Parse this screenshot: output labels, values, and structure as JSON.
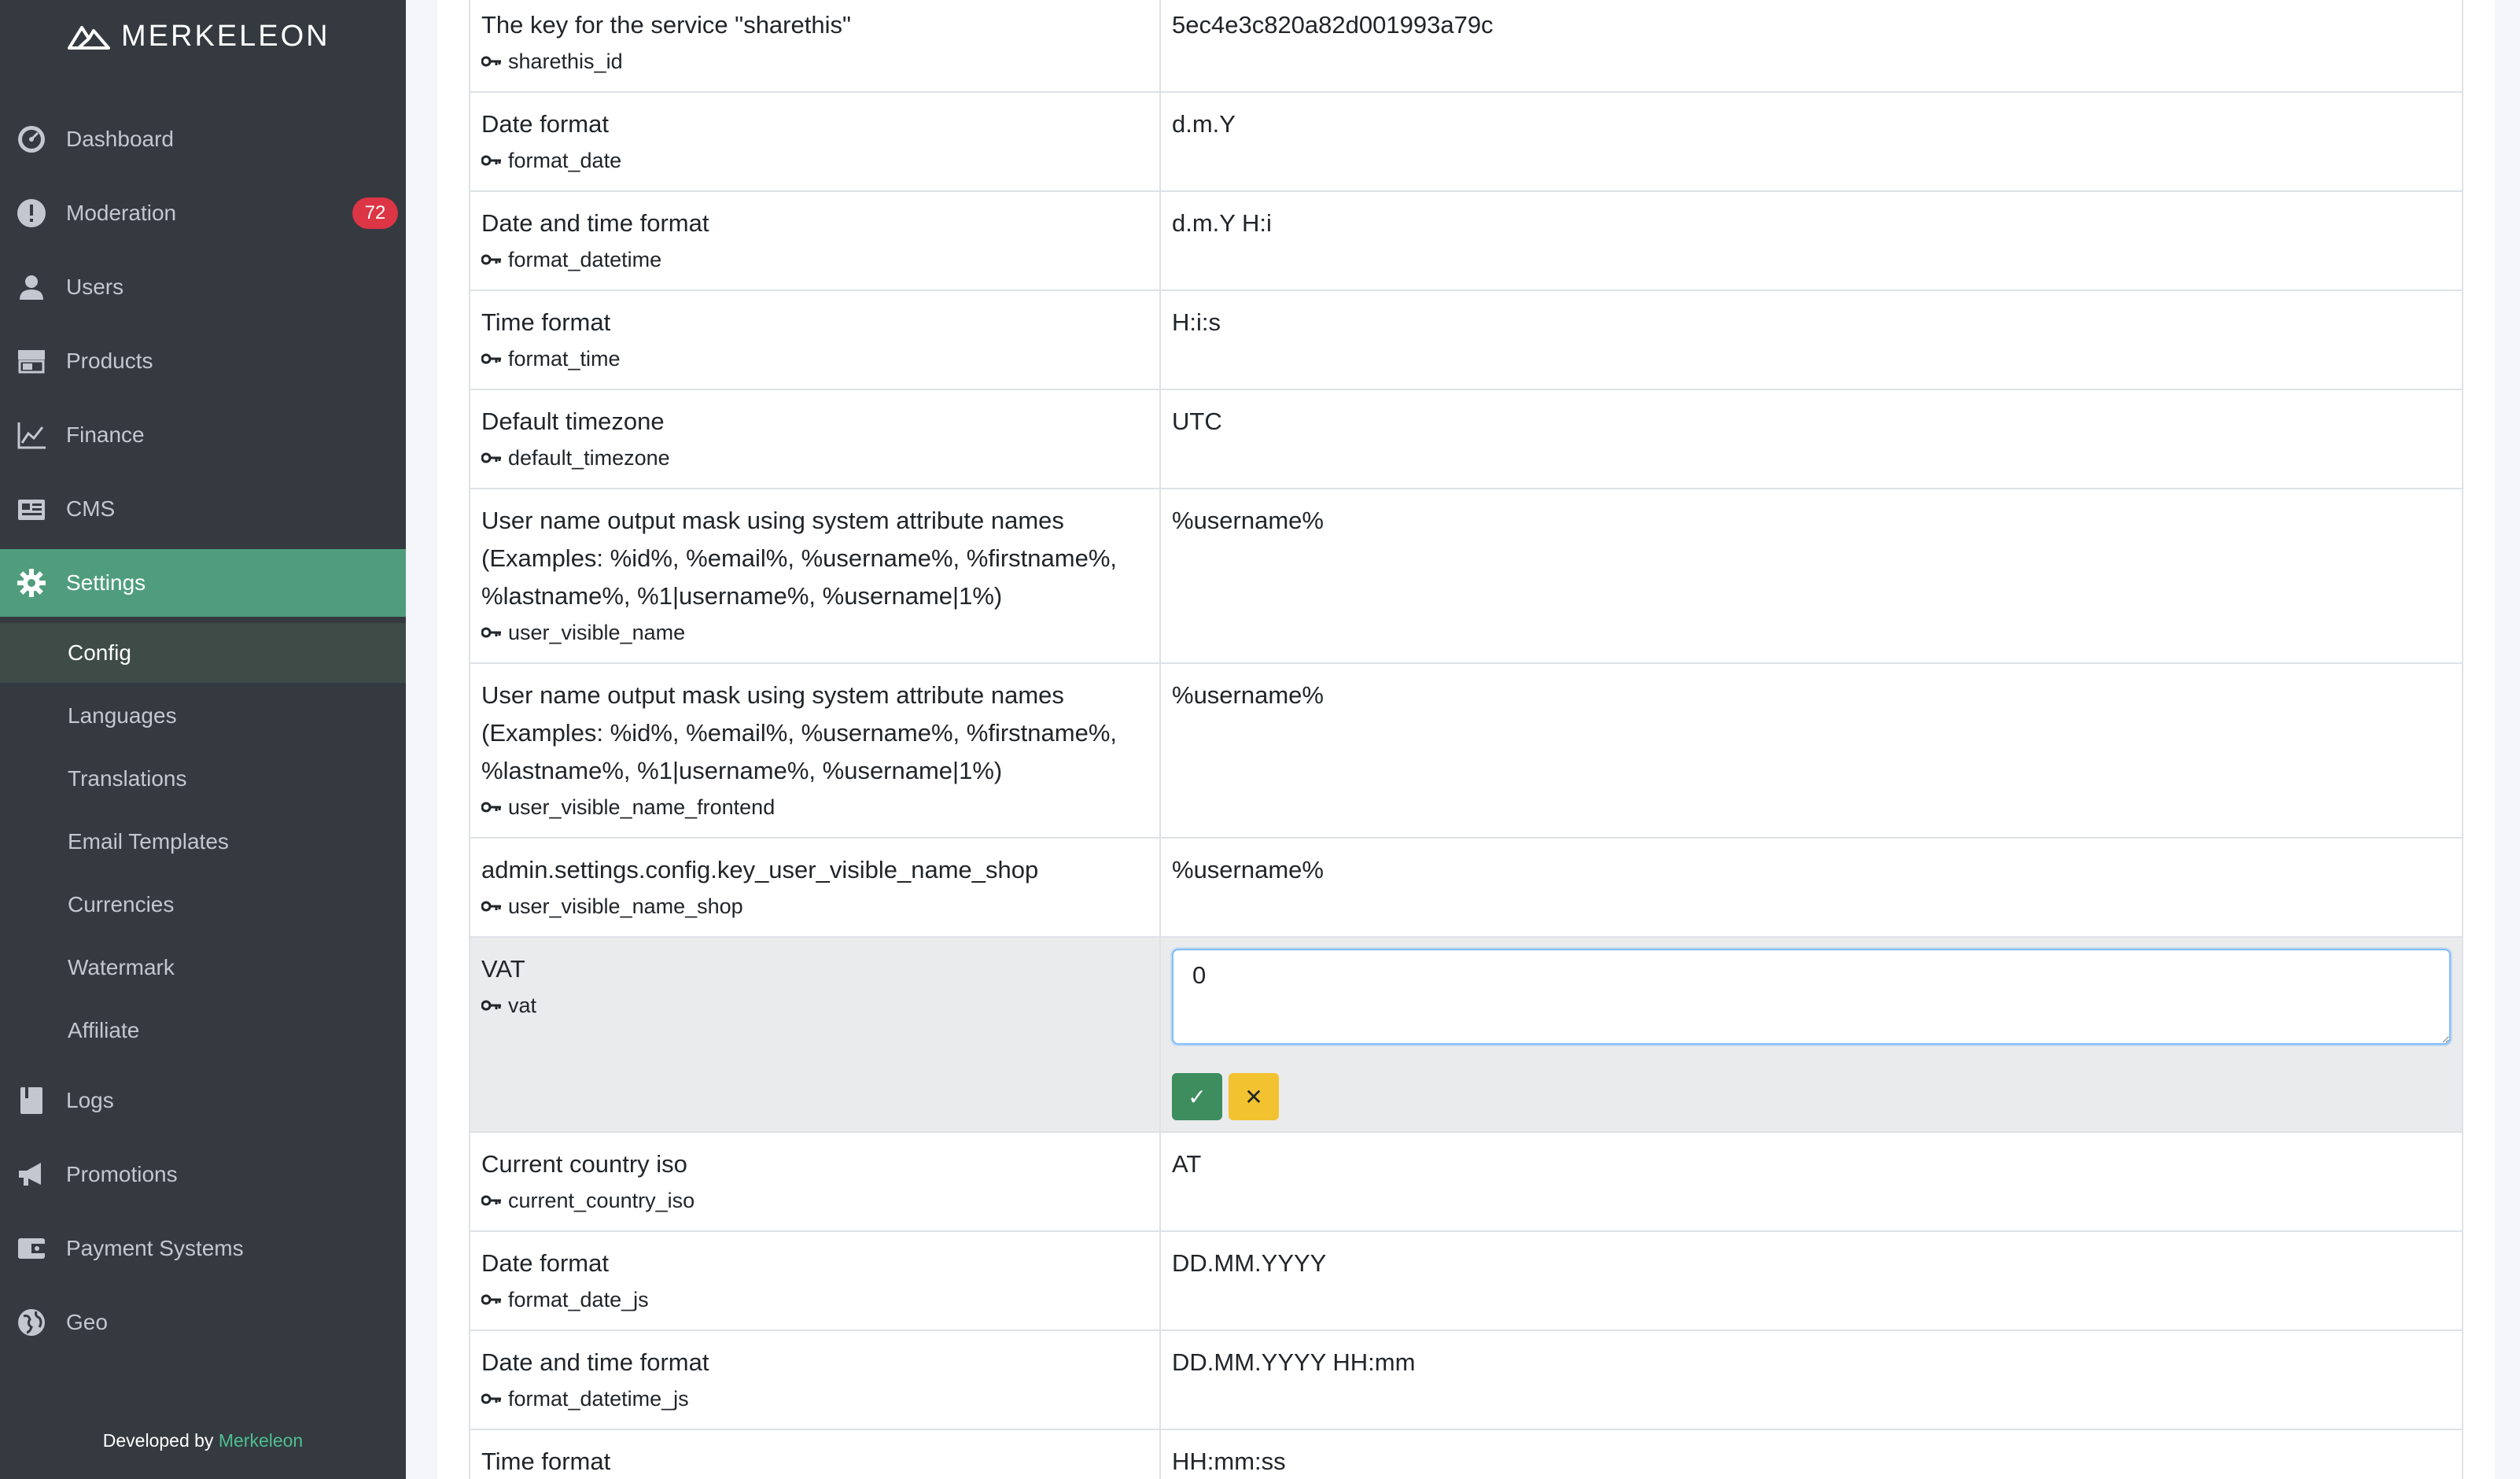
{
  "brand": {
    "name": "MERKELEON"
  },
  "nav": [
    {
      "label": "Dashboard",
      "icon": "dashboard-icon"
    },
    {
      "label": "Moderation",
      "icon": "alert-icon",
      "badge": "72"
    },
    {
      "label": "Users",
      "icon": "user-icon"
    },
    {
      "label": "Products",
      "icon": "store-icon"
    },
    {
      "label": "Finance",
      "icon": "chart-line-icon"
    },
    {
      "label": "CMS",
      "icon": "newspaper-icon"
    },
    {
      "label": "Settings",
      "icon": "gear-icon",
      "active": true
    }
  ],
  "settings_sub": [
    {
      "label": "Config",
      "active": true
    },
    {
      "label": "Languages"
    },
    {
      "label": "Translations"
    },
    {
      "label": "Email Templates"
    },
    {
      "label": "Currencies"
    },
    {
      "label": "Watermark"
    },
    {
      "label": "Affiliate"
    }
  ],
  "nav_bottom": [
    {
      "label": "Logs",
      "icon": "book-icon"
    },
    {
      "label": "Promotions",
      "icon": "megaphone-icon"
    },
    {
      "label": "Payment Systems",
      "icon": "wallet-icon"
    },
    {
      "label": "Geo",
      "icon": "globe-icon"
    }
  ],
  "footer": {
    "prefix": "Developed by",
    "link": "Merkeleon"
  },
  "rows": [
    {
      "title_lines": [
        "The key for the service \"sharethis\""
      ],
      "key": "sharethis_id",
      "value": "5ec4e3c820a82d001993a79c"
    },
    {
      "title_lines": [
        "Date format"
      ],
      "key": "format_date",
      "value": "d.m.Y"
    },
    {
      "title_lines": [
        "Date and time format"
      ],
      "key": "format_datetime",
      "value": "d.m.Y H:i"
    },
    {
      "title_lines": [
        "Time format"
      ],
      "key": "format_time",
      "value": "H:i:s"
    },
    {
      "title_lines": [
        "Default timezone"
      ],
      "key": "default_timezone",
      "value": "UTC"
    },
    {
      "title_lines": [
        "User name output mask using system attribute names",
        "(Examples: %id%, %email%, %username%, %firstname%,",
        "%lastname%, %1|username%, %username|1%)"
      ],
      "key": "user_visible_name",
      "value": "%username%"
    },
    {
      "title_lines": [
        "User name output mask using system attribute names",
        "(Examples: %id%, %email%, %username%, %firstname%,",
        "%lastname%, %1|username%, %username|1%)"
      ],
      "key": "user_visible_name_frontend",
      "value": "%username%"
    },
    {
      "title_lines": [
        "admin.settings.config.key_user_visible_name_shop"
      ],
      "key": "user_visible_name_shop",
      "value": "%username%"
    },
    {
      "title_lines": [
        "VAT"
      ],
      "key": "vat",
      "value": "0",
      "editing": true
    },
    {
      "title_lines": [
        "Current country iso"
      ],
      "key": "current_country_iso",
      "value": "AT"
    },
    {
      "title_lines": [
        "Date format"
      ],
      "key": "format_date_js",
      "value": "DD.MM.YYYY"
    },
    {
      "title_lines": [
        "Date and time format"
      ],
      "key": "format_datetime_js",
      "value": "DD.MM.YYYY HH:mm"
    },
    {
      "title_lines": [
        "Time format"
      ],
      "key": "",
      "value": "HH:mm:ss"
    }
  ],
  "edit_buttons": {
    "ok": "✓",
    "cancel": "✕"
  },
  "colors": {
    "sidebar": "#343a40",
    "active": "#4f9d7c",
    "badge": "#dc3545",
    "ok": "#3d8d5f",
    "cancel": "#f2c230"
  }
}
